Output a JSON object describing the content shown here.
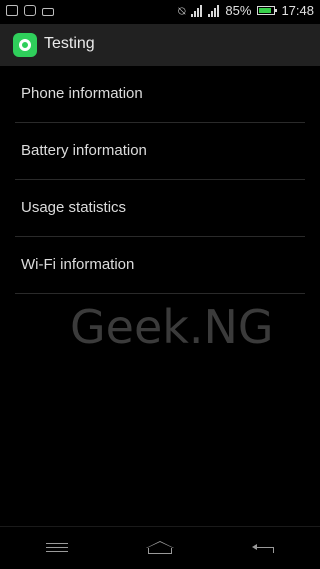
{
  "status_bar": {
    "left_icons": [
      "gallery-icon",
      "message-icon",
      "battery-small-icon"
    ],
    "battery_percent": "85%",
    "battery_level": 0.85,
    "time": "17:48"
  },
  "action_bar": {
    "title": "Testing",
    "icon": "gear-icon",
    "icon_color": "#2fcf5b"
  },
  "list": {
    "items": [
      {
        "label": "Phone information"
      },
      {
        "label": "Battery information"
      },
      {
        "label": "Usage statistics"
      },
      {
        "label": "Wi-Fi information"
      }
    ]
  },
  "watermark": "Geek.NG",
  "nav_bar": {
    "icons": [
      "menu-icon",
      "home-icon",
      "back-icon"
    ]
  }
}
